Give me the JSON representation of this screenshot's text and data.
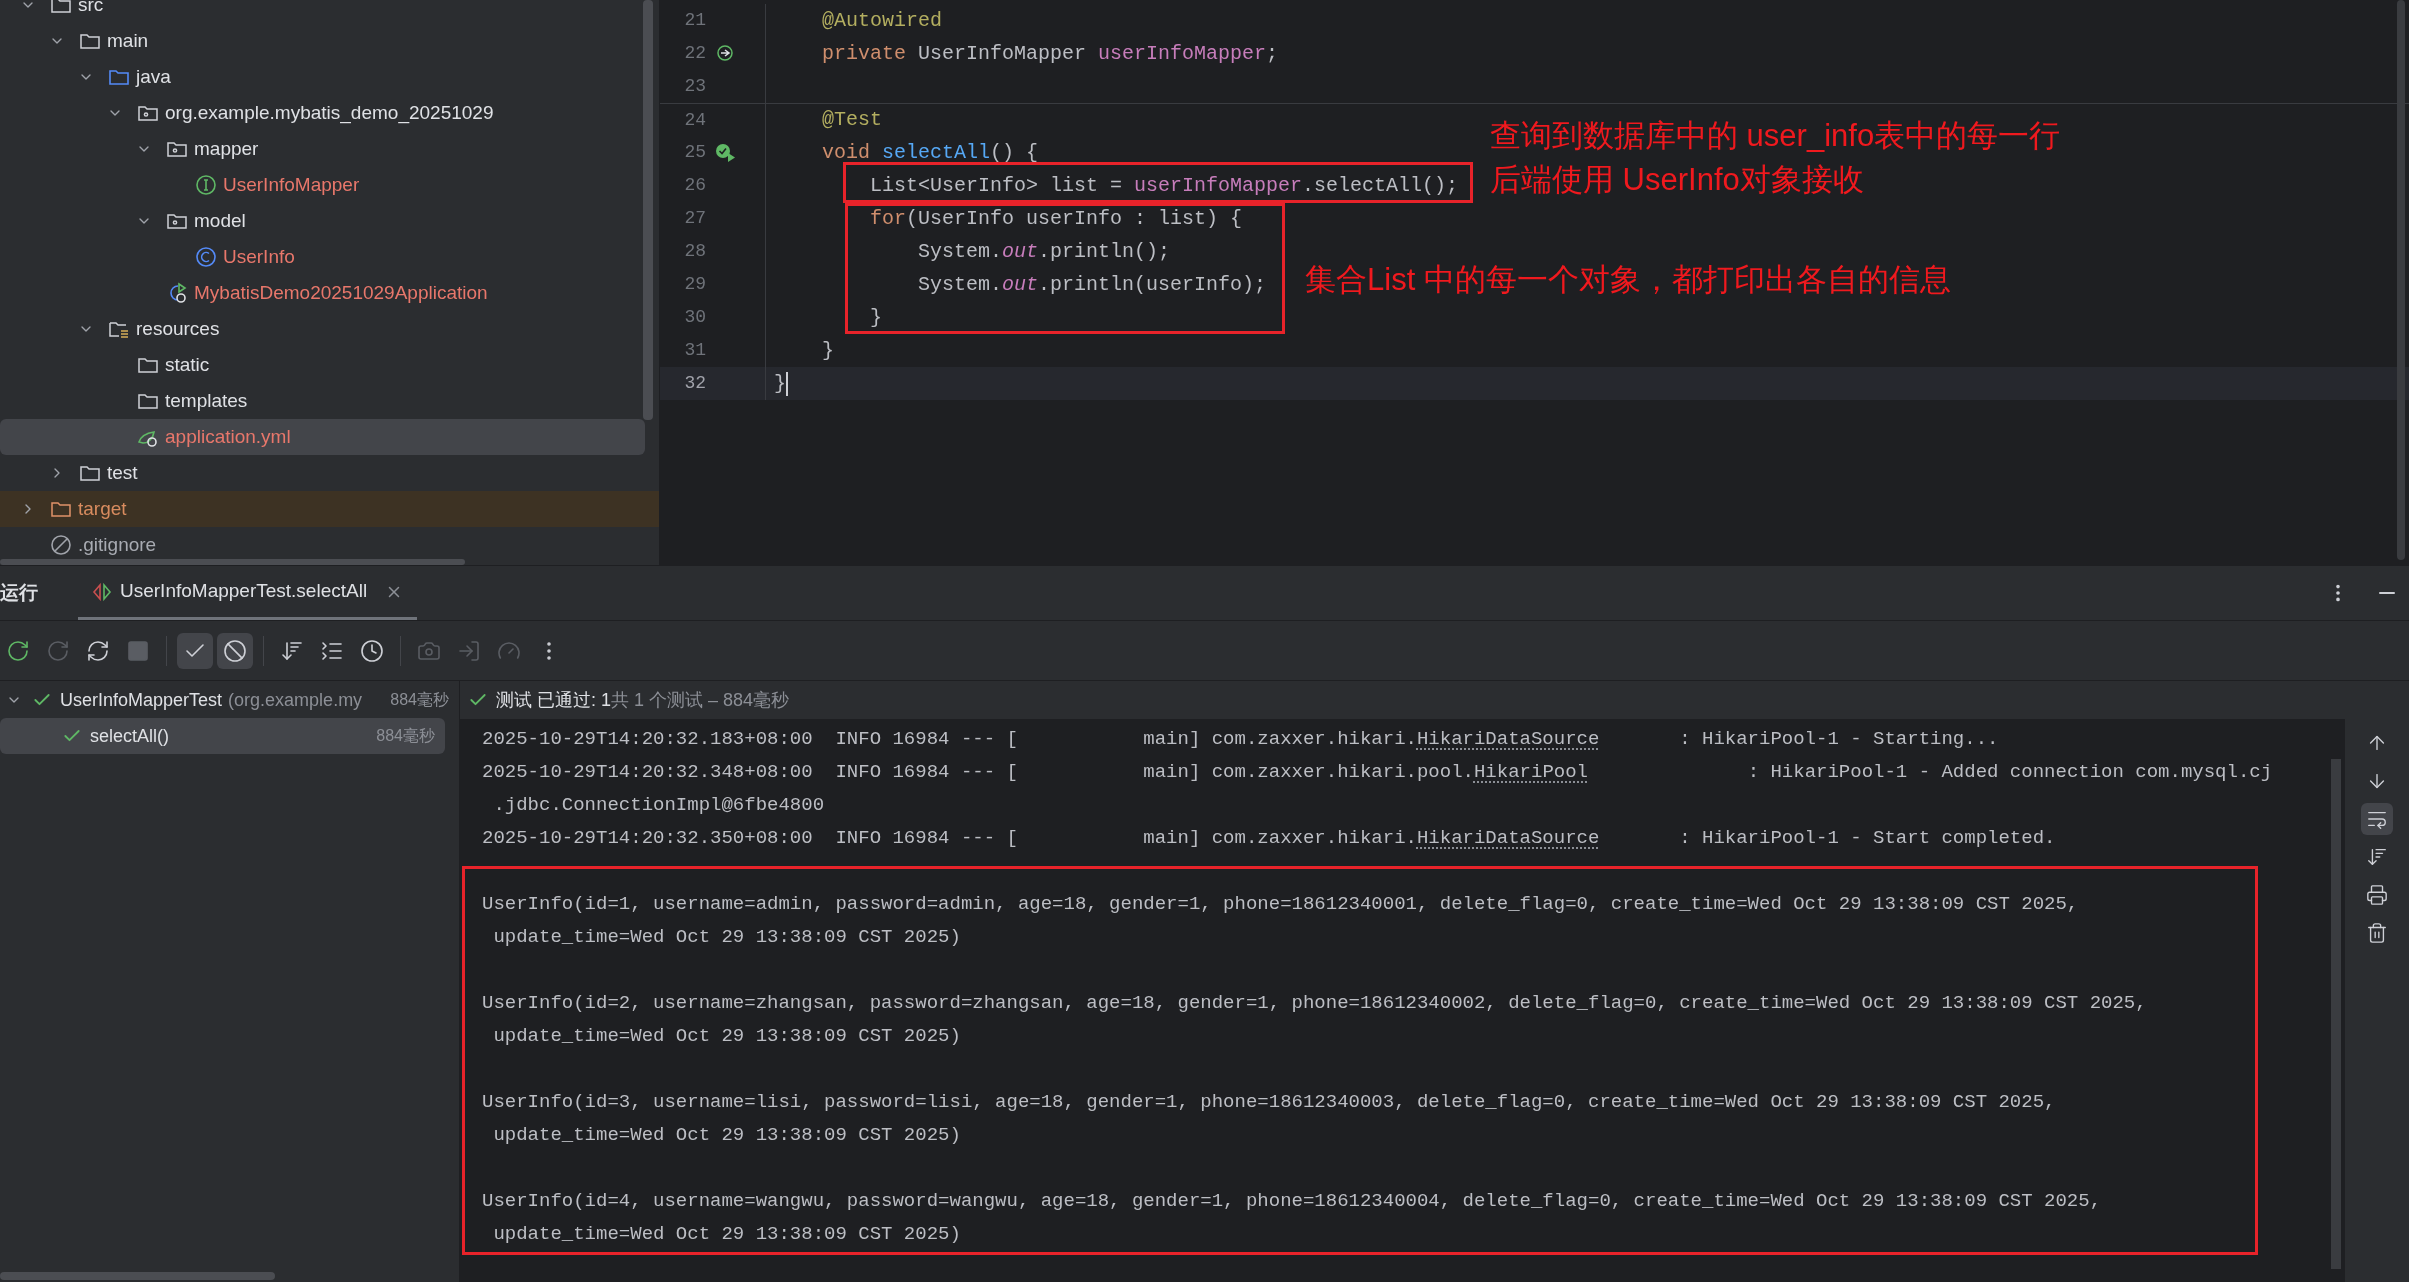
{
  "project_tree": [
    {
      "label": "src",
      "kind": "folder",
      "expanded": true,
      "selected": false,
      "children": [
        {
          "label": "main",
          "kind": "folder",
          "expanded": true,
          "selected": false,
          "children": [
            {
              "label": "java",
              "kind": "source-folder",
              "expanded": true,
              "selected": false,
              "children": [
                {
                  "label": "org.example.mybatis_demo_20251029",
                  "kind": "package",
                  "expanded": true,
                  "selected": false,
                  "children": [
                    {
                      "label": "mapper",
                      "kind": "package",
                      "expanded": true,
                      "selected": false,
                      "children": [
                        {
                          "label": "UserInfoMapper",
                          "kind": "interface",
                          "selected": false,
                          "untracked": true
                        }
                      ]
                    },
                    {
                      "label": "model",
                      "kind": "package",
                      "expanded": true,
                      "selected": false,
                      "children": [
                        {
                          "label": "UserInfo",
                          "kind": "class",
                          "selected": false,
                          "untracked": true
                        }
                      ]
                    },
                    {
                      "label": "MybatisDemo20251029Application",
                      "kind": "spring-app",
                      "selected": false,
                      "untracked": true
                    }
                  ]
                }
              ]
            },
            {
              "label": "resources",
              "kind": "resources-folder",
              "expanded": true,
              "selected": false,
              "children": [
                {
                  "label": "static",
                  "kind": "folder",
                  "selected": false
                },
                {
                  "label": "templates",
                  "kind": "folder",
                  "selected": false
                },
                {
                  "label": "application.yml",
                  "kind": "yml",
                  "selected": true,
                  "untracked": true
                }
              ]
            }
          ]
        },
        {
          "label": "test",
          "kind": "folder",
          "expanded": false,
          "selected": false
        }
      ]
    },
    {
      "label": "target",
      "kind": "excluded-folder",
      "expanded": false,
      "selected": false
    },
    {
      "label": ".gitignore",
      "kind": "ignore",
      "selected": false
    }
  ],
  "editor": {
    "lines": [
      {
        "number": "21",
        "tokens": [
          {
            "text": "    @Autowired",
            "kind": "annotation"
          }
        ]
      },
      {
        "number": "22",
        "marker": {
          "kind": "bean"
        },
        "tokens": [
          {
            "text": "    private",
            "kind": "keyword"
          },
          {
            "text": " UserInfoMapper ",
            "kind": "plain"
          },
          {
            "text": "userInfoMapper",
            "kind": "field"
          },
          {
            "text": ";",
            "kind": "plain"
          }
        ]
      },
      {
        "number": "23"
      },
      {
        "number": "24",
        "separator": true,
        "tokens": [
          {
            "text": "    @Test",
            "kind": "annotation"
          }
        ]
      },
      {
        "number": "25",
        "marker": {
          "kind": "run-passed"
        },
        "tokens": [
          {
            "text": "    void ",
            "kind": "keyword"
          },
          {
            "text": "selectAll",
            "kind": "method"
          },
          {
            "text": "() {",
            "kind": "plain"
          }
        ]
      },
      {
        "number": "26",
        "tokens": [
          {
            "text": "        List<UserInfo> list = ",
            "kind": "plain"
          },
          {
            "text": "userInfoMapper",
            "kind": "field"
          },
          {
            "text": ".selectAll();",
            "kind": "plain"
          }
        ]
      },
      {
        "number": "27",
        "tokens": [
          {
            "text": "        for",
            "kind": "keyword"
          },
          {
            "text": "(UserInfo userInfo : list) {",
            "kind": "plain"
          }
        ]
      },
      {
        "number": "28",
        "tokens": [
          {
            "text": "            System.",
            "kind": "plain"
          },
          {
            "text": "out",
            "kind": "static"
          },
          {
            "text": ".println();",
            "kind": "plain"
          }
        ]
      },
      {
        "number": "29",
        "tokens": [
          {
            "text": "            System.",
            "kind": "plain"
          },
          {
            "text": "out",
            "kind": "static"
          },
          {
            "text": ".println(userInfo);",
            "kind": "plain"
          }
        ]
      },
      {
        "number": "30",
        "tokens": [
          {
            "text": "        }",
            "kind": "plain"
          }
        ]
      },
      {
        "number": "31",
        "tokens": [
          {
            "text": "    }",
            "kind": "plain"
          }
        ]
      },
      {
        "number": "32",
        "current": true,
        "tokens": [
          {
            "text": "}",
            "kind": "plain"
          }
        ]
      }
    ]
  },
  "annotations": [
    {
      "lines": [
        "查询到数据库中的 user_info表中的每一行",
        "后端使用 UserInfo对象接收"
      ]
    },
    {
      "lines": [
        "集合List 中的每一个对象，都打印出各自的信息"
      ]
    }
  ],
  "run_panel": {
    "title": "运行",
    "tabs": [
      {
        "label": "UserInfoMapperTest.selectAll",
        "selected": true
      }
    ],
    "toolbar": [
      {
        "kind": "rerun"
      },
      {
        "kind": "rerun-failed",
        "disabled": true
      },
      {
        "kind": "auto-rerun"
      },
      {
        "kind": "stop",
        "disabled": true
      },
      {
        "kind": "separator"
      },
      {
        "kind": "show-passed",
        "on": true
      },
      {
        "kind": "show-ignored",
        "on": true
      },
      {
        "kind": "separator"
      },
      {
        "kind": "sort"
      },
      {
        "kind": "collapse"
      },
      {
        "kind": "history"
      },
      {
        "kind": "separator"
      },
      {
        "kind": "screenshot",
        "disabled": true
      },
      {
        "kind": "import",
        "disabled": true
      },
      {
        "kind": "gauge",
        "disabled": true
      },
      {
        "kind": "more"
      }
    ],
    "tests": [
      {
        "name": "UserInfoMapperTest",
        "detail": "(org.example.my",
        "time": "884毫秒",
        "expanded": true,
        "selected": false,
        "children": [
          {
            "name": "selectAll()",
            "time": "884毫秒",
            "selected": true
          }
        ]
      }
    ],
    "status": {
      "label": "测试 已通过: 1",
      "summary": "共 1 个测试 – 884毫秒"
    },
    "console": [
      {
        "kind": "log",
        "segments": [
          {
            "text": "2025-10-29T14:20:32.183+08:00  INFO 16984 --- [           main] com.zaxxer.hikari.",
            "link": false
          },
          {
            "text": "HikariDataSource",
            "link": true
          },
          {
            "text": "       : HikariPool-1 - Starting...",
            "link": false
          }
        ]
      },
      {
        "kind": "log",
        "segments": [
          {
            "text": "2025-10-29T14:20:32.348+08:00  INFO 16984 --- [           main] com.zaxxer.hikari.pool.",
            "link": false
          },
          {
            "text": "HikariPool",
            "link": true
          },
          {
            "text": "              : HikariPool-1 - Added connection com.mysql.cj",
            "link": false
          }
        ]
      },
      {
        "kind": "log",
        "segments": [
          {
            "text": " .jdbc.ConnectionImpl@6fbe4800",
            "link": false
          }
        ]
      },
      {
        "kind": "log",
        "segments": [
          {
            "text": "2025-10-29T14:20:32.350+08:00  INFO 16984 --- [           main] com.zaxxer.hikari.",
            "link": false
          },
          {
            "text": "HikariDataSource",
            "link": true
          },
          {
            "text": "       : HikariPool-1 - Start completed.",
            "link": false
          }
        ]
      },
      {
        "kind": "blank"
      },
      {
        "kind": "output",
        "segments": [
          {
            "text": "UserInfo(id=1, username=admin, password=admin, age=18, gender=1, phone=18612340001, delete_flag=0, create_time=Wed Oct 29 13:38:09 CST 2025,",
            "link": false
          }
        ]
      },
      {
        "kind": "output",
        "segments": [
          {
            "text": " update_time=Wed Oct 29 13:38:09 CST 2025)",
            "link": false
          }
        ]
      },
      {
        "kind": "blank"
      },
      {
        "kind": "output",
        "segments": [
          {
            "text": "UserInfo(id=2, username=zhangsan, password=zhangsan, age=18, gender=1, phone=18612340002, delete_flag=0, create_time=Wed Oct 29 13:38:09 CST 2025,",
            "link": false
          }
        ]
      },
      {
        "kind": "output",
        "segments": [
          {
            "text": " update_time=Wed Oct 29 13:38:09 CST 2025)",
            "link": false
          }
        ]
      },
      {
        "kind": "blank"
      },
      {
        "kind": "output",
        "segments": [
          {
            "text": "UserInfo(id=3, username=lisi, password=lisi, age=18, gender=1, phone=18612340003, delete_flag=0, create_time=Wed Oct 29 13:38:09 CST 2025,",
            "link": false
          }
        ]
      },
      {
        "kind": "output",
        "segments": [
          {
            "text": " update_time=Wed Oct 29 13:38:09 CST 2025)",
            "link": false
          }
        ]
      },
      {
        "kind": "blank"
      },
      {
        "kind": "output",
        "segments": [
          {
            "text": "UserInfo(id=4, username=wangwu, password=wangwu, age=18, gender=1, phone=18612340004, delete_flag=0, create_time=Wed Oct 29 13:38:09 CST 2025,",
            "link": false
          }
        ]
      },
      {
        "kind": "output",
        "segments": [
          {
            "text": " update_time=Wed Oct 29 13:38:09 CST 2025)",
            "link": false
          }
        ]
      }
    ],
    "side_tools": [
      {
        "kind": "up",
        "on": false
      },
      {
        "kind": "down",
        "on": false
      },
      {
        "kind": "wrap",
        "on": true
      },
      {
        "kind": "scroll-end",
        "on": false
      },
      {
        "kind": "print",
        "on": false
      },
      {
        "kind": "clear",
        "on": false
      }
    ]
  }
}
